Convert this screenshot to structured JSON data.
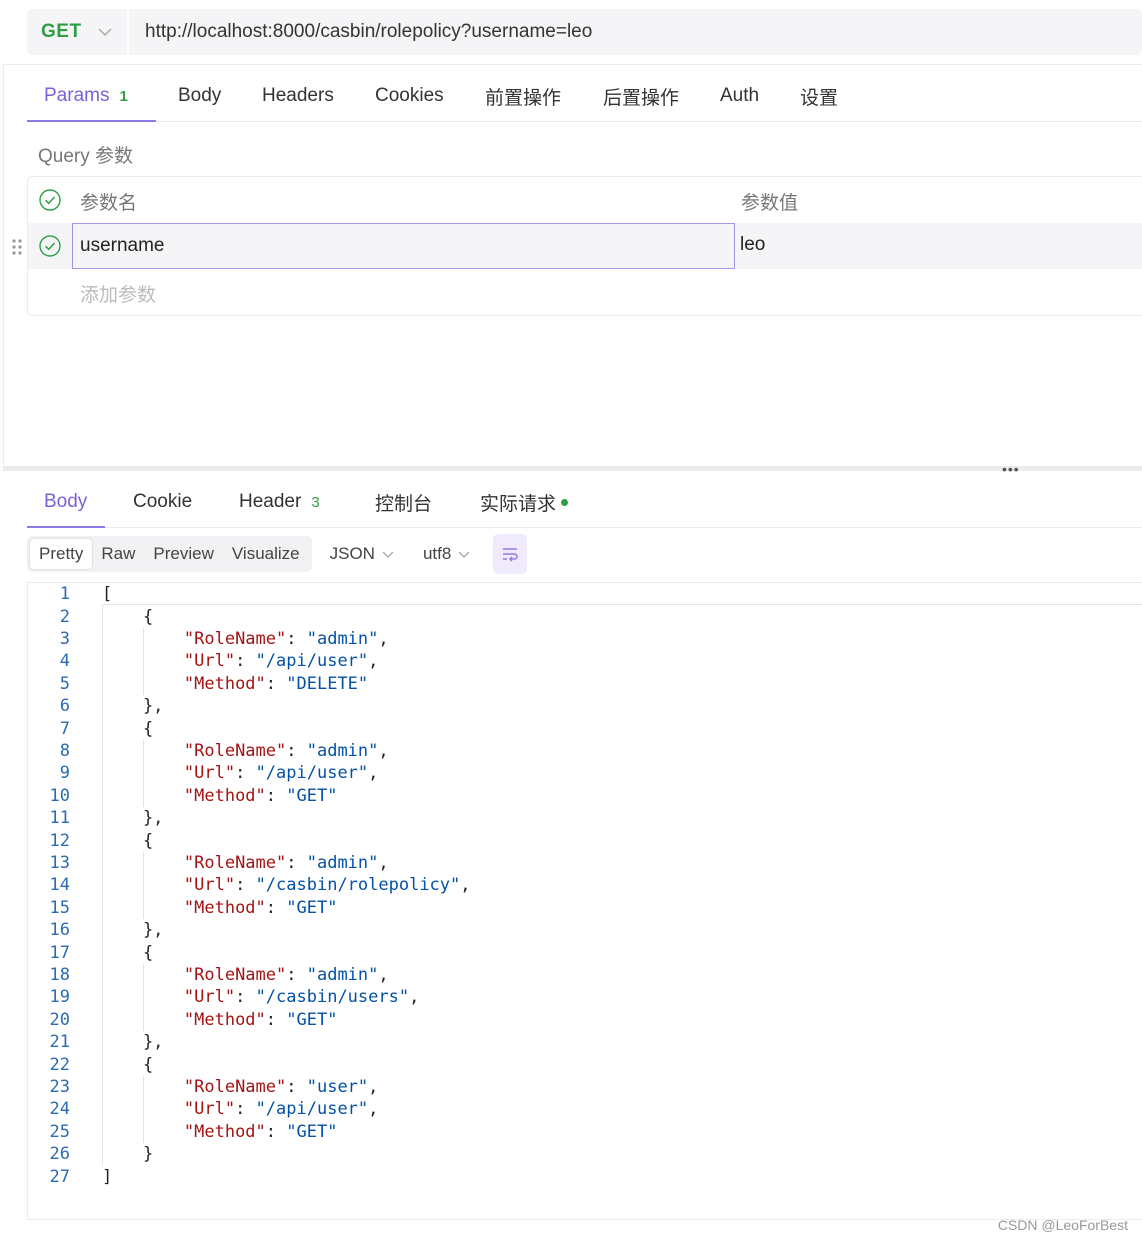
{
  "request": {
    "method": "GET",
    "url": "http://localhost:8000/casbin/rolepolicy?username=leo"
  },
  "request_tabs": [
    {
      "label": "Params",
      "badge": "1",
      "active": true
    },
    {
      "label": "Body"
    },
    {
      "label": "Headers"
    },
    {
      "label": "Cookies"
    },
    {
      "label": "前置操作"
    },
    {
      "label": "后置操作"
    },
    {
      "label": "Auth"
    },
    {
      "label": "设置"
    }
  ],
  "query": {
    "section_title": "Query 参数",
    "header_name": "参数名",
    "header_value": "参数值",
    "rows": [
      {
        "key": "username",
        "value": "leo",
        "enabled": true
      }
    ],
    "add_placeholder": "添加参数"
  },
  "pane_divider_glyph": "•••",
  "response_tabs": [
    {
      "label": "Body",
      "active": true
    },
    {
      "label": "Cookie"
    },
    {
      "label": "Header",
      "badge": "3"
    },
    {
      "label": "控制台"
    },
    {
      "label": "实际请求"
    }
  ],
  "view_modes": [
    "Pretty",
    "Raw",
    "Preview",
    "Visualize"
  ],
  "active_view_mode": "Pretty",
  "format": "JSON",
  "encoding": "utf8",
  "response_body": [
    {
      "RoleName": "admin",
      "Url": "/api/user",
      "Method": "DELETE"
    },
    {
      "RoleName": "admin",
      "Url": "/api/user",
      "Method": "GET"
    },
    {
      "RoleName": "admin",
      "Url": "/casbin/rolepolicy",
      "Method": "GET"
    },
    {
      "RoleName": "admin",
      "Url": "/casbin/users",
      "Method": "GET"
    },
    {
      "RoleName": "user",
      "Url": "/api/user",
      "Method": "GET"
    }
  ],
  "colors": {
    "accent": "#7b61d9",
    "method_get": "#2ea043",
    "json_key": "#a31515",
    "json_string": "#0451a5",
    "line_number": "#2a6bb3"
  },
  "watermark": "CSDN @LeoForBest"
}
